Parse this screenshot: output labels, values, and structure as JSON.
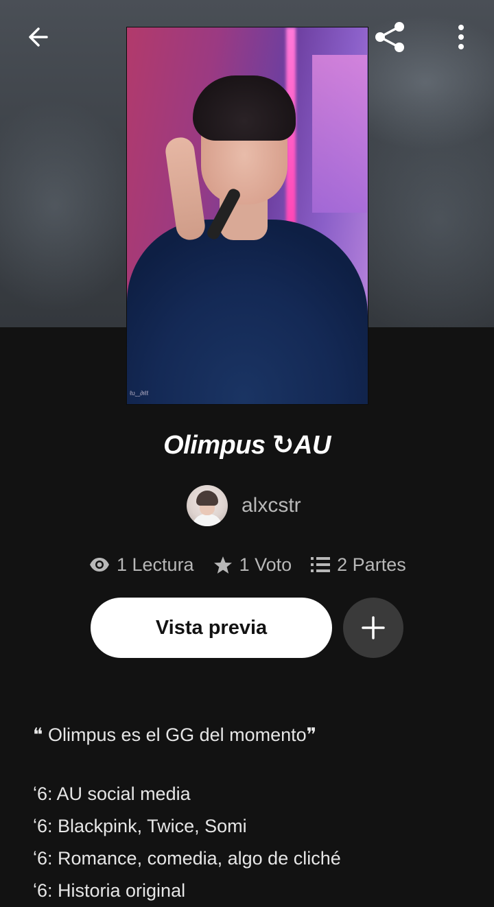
{
  "story": {
    "title": "Olimpus ↻AU",
    "author": "alxcstr",
    "cover_watermark": "ℓυ‿∂ιℓℓ"
  },
  "stats": {
    "reads": "1 Lectura",
    "votes": "1 Voto",
    "parts": "2 Partes"
  },
  "actions": {
    "preview_label": "Vista previa"
  },
  "description": {
    "tagline": "❝ Olimpus es el GG del momento❞",
    "items": [
      "ʻ6: AU social media",
      "ʻ6: Blackpink, Twice, Somi",
      "ʻ6: Romance, comedia, algo de cliché",
      "ʻ6: Historia original"
    ]
  },
  "icons": {
    "back": "arrow-left-icon",
    "share": "share-icon",
    "more": "more-vertical-icon",
    "reads": "eye-icon",
    "votes": "star-icon",
    "parts": "list-icon",
    "add": "plus-icon"
  },
  "colors": {
    "background": "#121212",
    "button_bg": "#ffffff",
    "add_button_bg": "#3a3a3a",
    "muted_text": "#b8b8b8"
  }
}
